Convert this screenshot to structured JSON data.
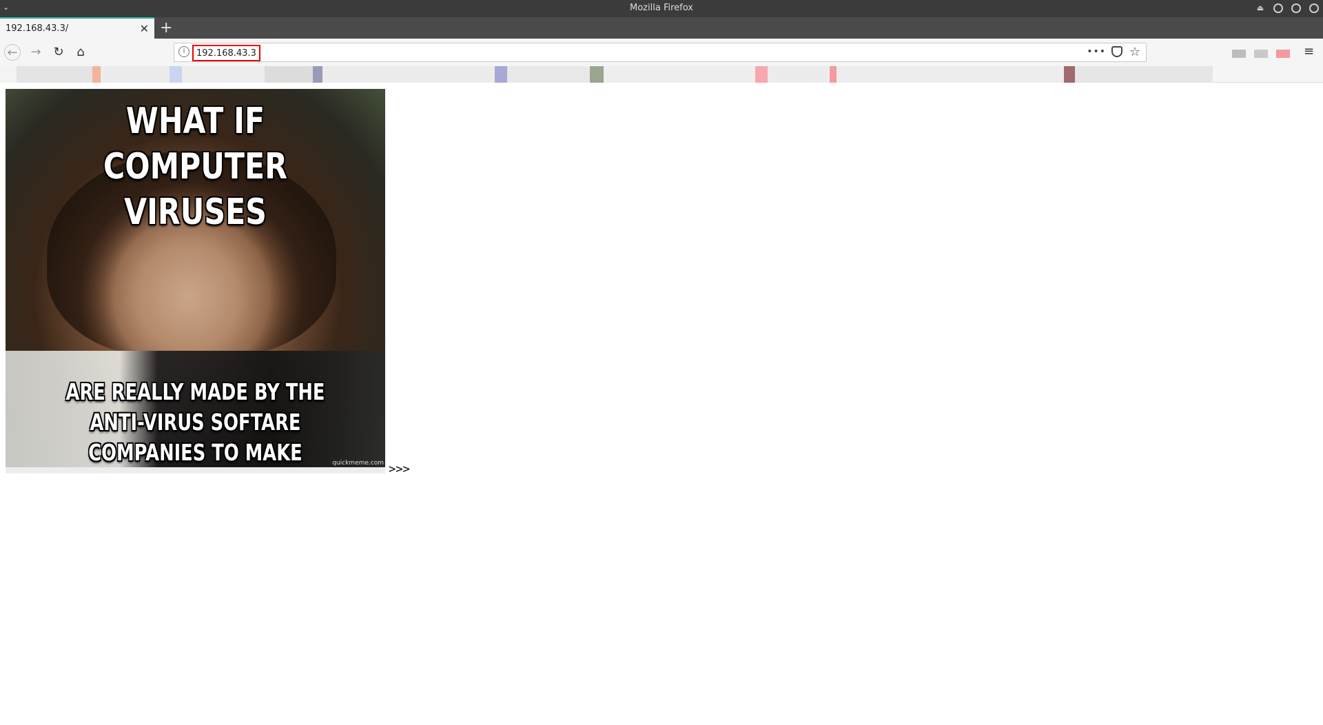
{
  "window": {
    "title": "Mozilla Firefox"
  },
  "tabs": [
    {
      "label": "192.168.43.3/",
      "close": "✕"
    }
  ],
  "new_tab": "+",
  "nav": {
    "url": "192.168.43.3",
    "info": "i",
    "dots": "•••",
    "star": "☆",
    "hamburger": "≡"
  },
  "page": {
    "meme": {
      "top_text": "WHAT IF COMPUTER VIRUSES",
      "bottom_text": "ARE REALLY MADE BY THE ANTI-VIRUS SOFTARE COMPANIES TO MAKE MONEY?",
      "watermark": "quickmeme.com"
    },
    "link_text": ">>>"
  },
  "colors": {
    "titlebar": "#3b3b3b",
    "tab_accent": "#29b6ac",
    "url_highlight": "#e00000"
  }
}
